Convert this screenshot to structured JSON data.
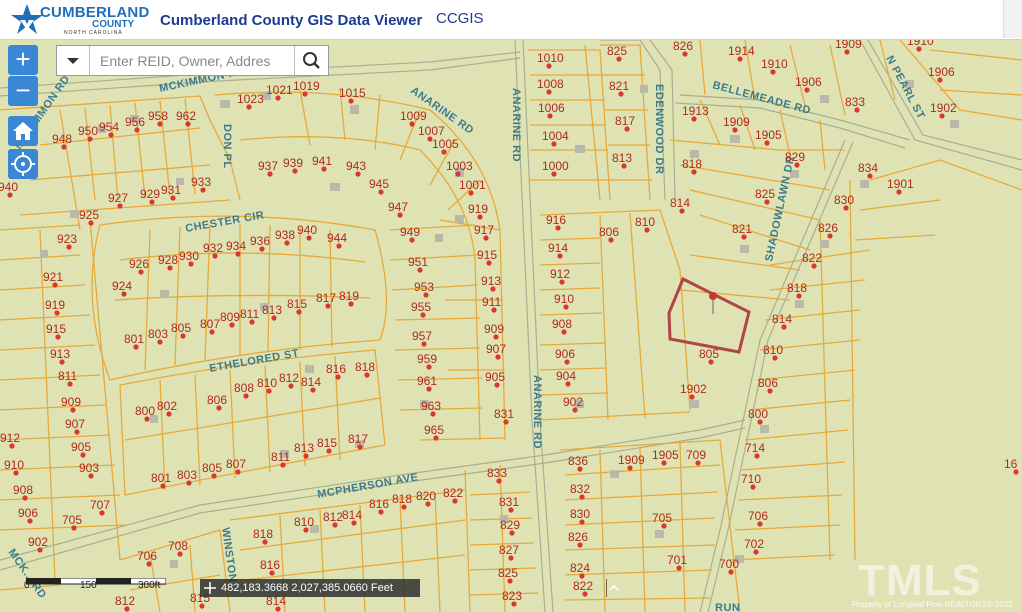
{
  "header": {
    "logo_name": "CUMBERLAND",
    "logo_sub": "COUNTY",
    "logo_state": "NORTH CAROLINA",
    "title": "Cumberland County GIS Data Viewer",
    "link": "CCGIS"
  },
  "controls": {
    "zoom_in": "+",
    "zoom_out": "−"
  },
  "search": {
    "placeholder": "Enter REID, Owner, Addres"
  },
  "streets": {
    "mckimmon": "MCKIMMON RD",
    "anarine_upper": "ANARINE RD",
    "anarine_mid": "ANARINE RD",
    "anarine_low": "ANARINE RD",
    "edenwood": "EDENWOOD DR",
    "bellemeade": "BELLEMEADE RD",
    "n_pearl": "N PEARL ST",
    "don": "DON PL",
    "chester": "CHESTER CIR",
    "ethelored": "ETHELORED ST",
    "mcpherson": "MCPHERSON AVE",
    "shadowlawn": "SHADOWLAWN DR",
    "winston": "WINSTON",
    "mcd_left": "MCK... RD",
    "run": "RUN"
  },
  "parcels": [
    [
      "826",
      683,
      50
    ],
    [
      "1914",
      738,
      55
    ],
    [
      "1909",
      845,
      48
    ],
    [
      "1910",
      917,
      45
    ],
    [
      "825",
      617,
      55
    ],
    [
      "1010",
      547,
      62
    ],
    [
      "1910",
      771,
      68
    ],
    [
      "1906",
      805,
      86
    ],
    [
      "1906",
      938,
      76
    ],
    [
      "1008",
      547,
      88
    ],
    [
      "821",
      619,
      90
    ],
    [
      "833",
      855,
      106
    ],
    [
      "1902",
      940,
      112
    ],
    [
      "1023",
      247,
      103
    ],
    [
      "1021",
      276,
      94
    ],
    [
      "1019",
      303,
      90
    ],
    [
      "1015",
      349,
      97
    ],
    [
      "1009",
      410,
      120
    ],
    [
      "1006",
      548,
      112
    ],
    [
      "1913",
      692,
      115
    ],
    [
      "1909",
      733,
      126
    ],
    [
      "817",
      625,
      125
    ],
    [
      "1905",
      765,
      139
    ],
    [
      "1004",
      552,
      140
    ],
    [
      "829",
      795,
      161
    ],
    [
      "1007",
      428,
      135
    ],
    [
      "1005",
      442,
      148
    ],
    [
      "948",
      62,
      143
    ],
    [
      "950",
      88,
      135
    ],
    [
      "954",
      109,
      131
    ],
    [
      "956",
      135,
      126
    ],
    [
      "958",
      158,
      120
    ],
    [
      "962",
      186,
      120
    ],
    [
      "813",
      622,
      162
    ],
    [
      "1000",
      552,
      170
    ],
    [
      "818",
      692,
      168
    ],
    [
      "834",
      868,
      172
    ],
    [
      "940",
      8,
      191
    ],
    [
      "937",
      268,
      170
    ],
    [
      "939",
      293,
      167
    ],
    [
      "941",
      322,
      165
    ],
    [
      "943",
      356,
      170
    ],
    [
      "1003",
      456,
      170
    ],
    [
      "945",
      379,
      188
    ],
    [
      "1001",
      469,
      189
    ],
    [
      "933",
      201,
      186
    ],
    [
      "929",
      150,
      198
    ],
    [
      "931",
      171,
      194
    ],
    [
      "927",
      118,
      202
    ],
    [
      "1901",
      897,
      188
    ],
    [
      "825",
      765,
      198
    ],
    [
      "830",
      844,
      204
    ],
    [
      "814",
      680,
      207
    ],
    [
      "925",
      89,
      219
    ],
    [
      "947",
      398,
      211
    ],
    [
      "919",
      478,
      213
    ],
    [
      "916",
      556,
      224
    ],
    [
      "810",
      645,
      226
    ],
    [
      "806",
      609,
      236
    ],
    [
      "821",
      742,
      233
    ],
    [
      "826",
      828,
      232
    ],
    [
      "923",
      67,
      243
    ],
    [
      "938",
      285,
      239
    ],
    [
      "940",
      307,
      234
    ],
    [
      "944",
      337,
      242
    ],
    [
      "936",
      260,
      245
    ],
    [
      "934",
      236,
      250
    ],
    [
      "932",
      213,
      252
    ],
    [
      "949",
      410,
      236
    ],
    [
      "917",
      484,
      234
    ],
    [
      "914",
      558,
      252
    ],
    [
      "928",
      168,
      264
    ],
    [
      "930",
      189,
      260
    ],
    [
      "926",
      139,
      268
    ],
    [
      "915",
      487,
      259
    ],
    [
      "822",
      812,
      262
    ],
    [
      "951",
      418,
      266
    ],
    [
      "921",
      53,
      281
    ],
    [
      "913",
      491,
      285
    ],
    [
      "912",
      560,
      278
    ],
    [
      "818",
      797,
      292
    ],
    [
      "924",
      122,
      290
    ],
    [
      "953",
      424,
      291
    ],
    [
      "910",
      564,
      303
    ],
    [
      "919",
      55,
      309
    ],
    [
      "955",
      421,
      311
    ],
    [
      "911",
      492,
      306
    ],
    [
      "817",
      326,
      302
    ],
    [
      "819",
      349,
      300
    ],
    [
      "815",
      297,
      308
    ],
    [
      "813",
      272,
      314
    ],
    [
      "811",
      250,
      318
    ],
    [
      "809",
      230,
      321
    ],
    [
      "807",
      210,
      328
    ],
    [
      "805",
      181,
      332
    ],
    [
      "803",
      158,
      338
    ],
    [
      "801",
      134,
      343
    ],
    [
      "908",
      562,
      328
    ],
    [
      "814",
      782,
      323
    ],
    [
      "915",
      56,
      333
    ],
    [
      "909",
      494,
      333
    ],
    [
      "957",
      422,
      340
    ],
    [
      "913",
      60,
      358
    ],
    [
      "907",
      496,
      353
    ],
    [
      "906",
      565,
      358
    ],
    [
      "805",
      709,
      358
    ],
    [
      "810",
      773,
      354
    ],
    [
      "818",
      365,
      371
    ],
    [
      "816",
      336,
      373
    ],
    [
      "959",
      427,
      363
    ],
    [
      "811",
      68,
      380
    ],
    [
      "814",
      311,
      386
    ],
    [
      "812",
      289,
      382
    ],
    [
      "810",
      267,
      387
    ],
    [
      "808",
      244,
      392
    ],
    [
      "961",
      427,
      385
    ],
    [
      "905",
      495,
      381
    ],
    [
      "904",
      566,
      380
    ],
    [
      "806",
      768,
      387
    ],
    [
      "1902",
      690,
      393
    ],
    [
      "806",
      217,
      404
    ],
    [
      "802",
      167,
      410
    ],
    [
      "800",
      145,
      415
    ],
    [
      "909",
      71,
      406
    ],
    [
      "902",
      573,
      406
    ],
    [
      "963",
      431,
      410
    ],
    [
      "831",
      504,
      418
    ],
    [
      "800",
      758,
      418
    ],
    [
      "907",
      75,
      428
    ],
    [
      "965",
      434,
      434
    ],
    [
      "817",
      358,
      443
    ],
    [
      "815",
      327,
      447
    ],
    [
      "813",
      304,
      452
    ],
    [
      "811",
      281,
      461
    ],
    [
      "905",
      81,
      451
    ],
    [
      "912",
      10,
      442
    ],
    [
      "714",
      755,
      452
    ],
    [
      "836",
      578,
      465
    ],
    [
      "1909",
      628,
      464
    ],
    [
      "1905",
      662,
      459
    ],
    [
      "709",
      696,
      459
    ],
    [
      "910",
      14,
      469
    ],
    [
      "903",
      89,
      472
    ],
    [
      "807",
      236,
      468
    ],
    [
      "805",
      212,
      472
    ],
    [
      "803",
      187,
      479
    ],
    [
      "801",
      161,
      482
    ],
    [
      "833",
      497,
      477
    ],
    [
      "908",
      23,
      494
    ],
    [
      "822",
      453,
      497
    ],
    [
      "820",
      426,
      500
    ],
    [
      "818",
      402,
      503
    ],
    [
      "816",
      379,
      508
    ],
    [
      "710",
      751,
      483
    ],
    [
      "832",
      580,
      493
    ],
    [
      "831",
      509,
      506
    ],
    [
      "707",
      100,
      509
    ],
    [
      "814",
      352,
      519
    ],
    [
      "812",
      333,
      521
    ],
    [
      "810",
      304,
      526
    ],
    [
      "830",
      580,
      518
    ],
    [
      "906",
      28,
      517
    ],
    [
      "705",
      72,
      524
    ],
    [
      "818",
      263,
      538
    ],
    [
      "829",
      510,
      529
    ],
    [
      "705",
      662,
      522
    ],
    [
      "706",
      758,
      520
    ],
    [
      "826",
      578,
      541
    ],
    [
      "16",
      1014,
      468
    ],
    [
      "902",
      38,
      546
    ],
    [
      "702",
      754,
      548
    ],
    [
      "706",
      147,
      560
    ],
    [
      "708",
      178,
      550
    ],
    [
      "827",
      509,
      554
    ],
    [
      "816",
      270,
      569
    ],
    [
      "701",
      677,
      564
    ],
    [
      "700",
      729,
      568
    ],
    [
      "824",
      580,
      572
    ],
    [
      "825",
      508,
      577
    ],
    [
      "822",
      583,
      590
    ],
    [
      "812",
      125,
      605
    ],
    [
      "815",
      200,
      602
    ],
    [
      "814",
      276,
      605
    ],
    [
      "823",
      512,
      600
    ]
  ]
}
